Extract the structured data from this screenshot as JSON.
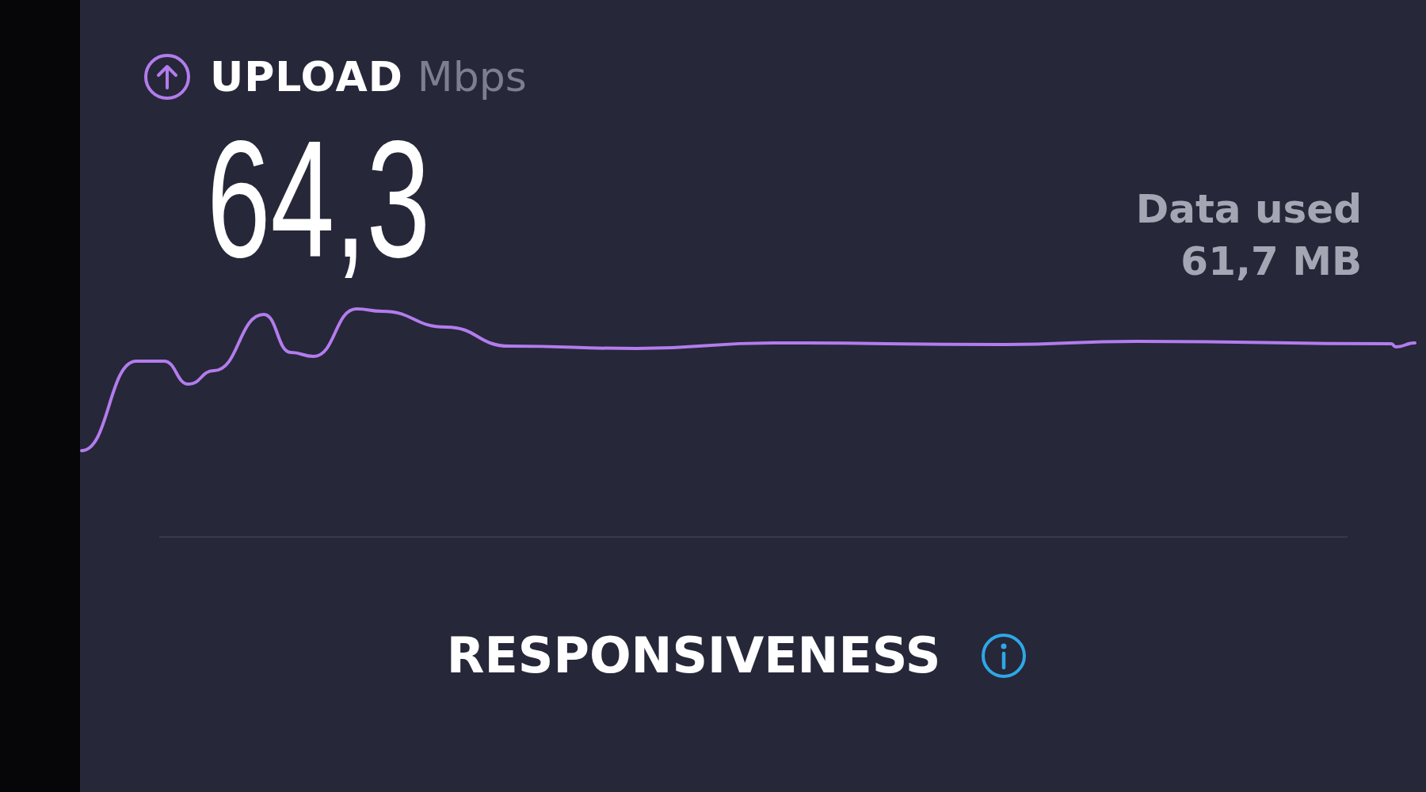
{
  "upload": {
    "label": "UPLOAD",
    "unit": "Mbps",
    "value": "64,3"
  },
  "data_used": {
    "label": "Data used",
    "value": "61,7 MB"
  },
  "responsiveness": {
    "title": "RESPONSIVENESS"
  }
}
